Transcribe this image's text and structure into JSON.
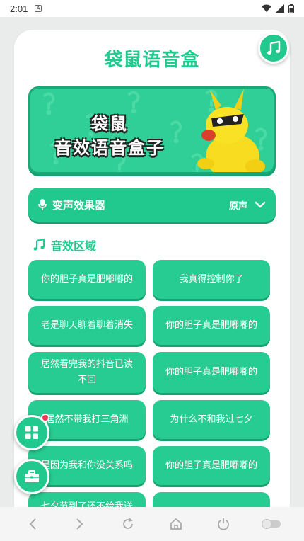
{
  "status": {
    "time": "2:01",
    "notif": "A"
  },
  "app": {
    "title": "袋鼠语音盒"
  },
  "banner": {
    "line1": "袋鼠",
    "line2": "音效语音盒子"
  },
  "voice_changer": {
    "label": "变声效果器",
    "value": "原声"
  },
  "section": {
    "title": "音效区域"
  },
  "sounds": [
    "你的胆子真是肥嘟嘟的",
    "我真得控制你了",
    "老是聊天聊着聊着消失",
    "你的胆子真是肥嘟嘟的",
    "居然看完我的抖音已读不回",
    "你的胆子真是肥嘟嘟的",
    "居然不带我打三角洲",
    "为什么不和我过七夕",
    "是因为我和你没关系吗",
    "你的胆子真是肥嘟嘟的",
    "七夕节到了还不给我送",
    ""
  ],
  "colors": {
    "accent": "#22c98e",
    "accent_dark": "#17a070",
    "title": "#1fcc90",
    "badge": "#f2354a"
  },
  "icons": [
    "music-note-icon",
    "mic-icon",
    "chevron-down-icon",
    "grid-icon",
    "toolbox-icon"
  ]
}
